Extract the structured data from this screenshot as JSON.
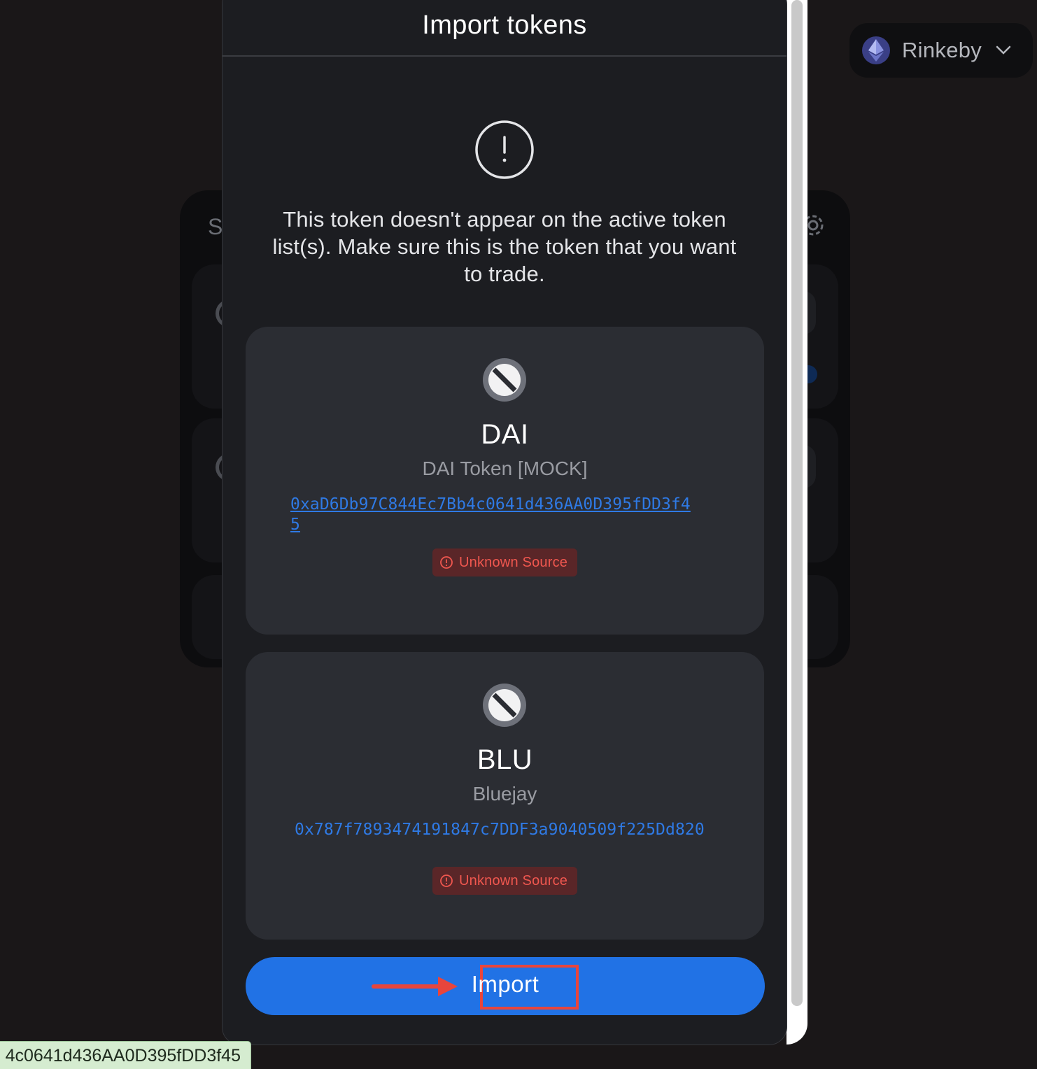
{
  "network": {
    "name": "Rinkeby",
    "icon": "ethereum-icon"
  },
  "swap_card": {
    "title_fragment": "S"
  },
  "modal": {
    "title": "Import tokens",
    "warning": "This token doesn't appear on the active token list(s). Make sure this is the token that you want to trade.",
    "tokens": [
      {
        "symbol": "DAI",
        "name": "DAI Token [MOCK]",
        "address_line1": "0xaD6Db97C844Ec7Bb4c0641d436AA0D395fDD3f4",
        "address_line2": "5",
        "badge": "Unknown Source",
        "icon": "blocked-icon"
      },
      {
        "symbol": "BLU",
        "name": "Bluejay",
        "address": "0x787f7893474191847c7DDF3a9040509f225Dd820",
        "badge": "Unknown Source",
        "icon": "blocked-icon"
      }
    ],
    "import_label": "Import"
  },
  "status_bar": {
    "url_fragment": "4c0641d436AA0D395fDD3f45"
  },
  "colors": {
    "accent": "#2172e5",
    "badge_text": "#f0574f",
    "badge_bg": "#5a2628",
    "annotation": "#e8453c"
  }
}
